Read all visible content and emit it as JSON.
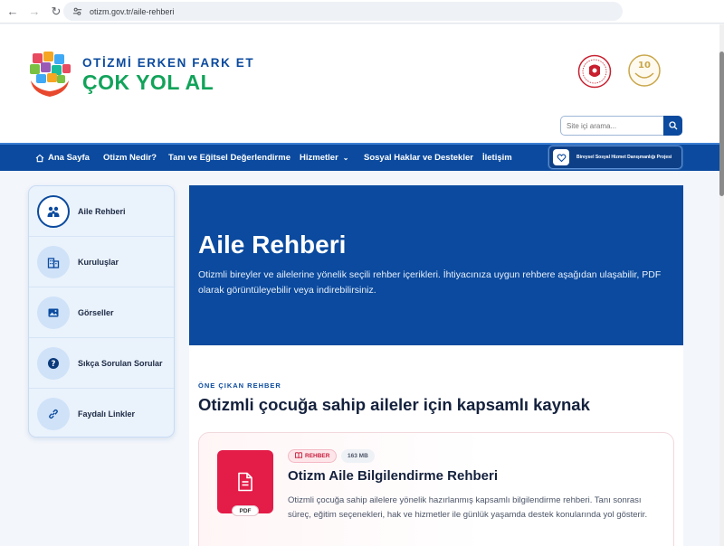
{
  "browser": {
    "url": "otizm.gov.tr/aile-rehberi"
  },
  "header": {
    "logo_line1": "OTİZMİ ERKEN FARK ET",
    "logo_line2": "ÇOK YOL AL",
    "search_placeholder": "Site içi arama..."
  },
  "nav": {
    "items": [
      {
        "label": "Ana Sayfa"
      },
      {
        "label": "Otizm Nedir?"
      },
      {
        "label": "Tanı ve Eğitsel Değerlendirme"
      },
      {
        "label": "Hizmetler"
      },
      {
        "label": "Sosyal Haklar ve Destekler"
      },
      {
        "label": "İletişim"
      }
    ],
    "project_label": "Bireysel Sosyal Hizmet Danışmanlığı Projesi"
  },
  "sidebar": {
    "items": [
      {
        "label": "Aile Rehberi",
        "icon": "family-icon",
        "active": true
      },
      {
        "label": "Kuruluşlar",
        "icon": "building-icon",
        "active": false
      },
      {
        "label": "Görseller",
        "icon": "image-icon",
        "active": false
      },
      {
        "label": "Sıkça Sorulan Sorular",
        "icon": "question-icon",
        "active": false
      },
      {
        "label": "Faydalı Linkler",
        "icon": "link-icon",
        "active": false
      }
    ]
  },
  "hero": {
    "title": "Aile Rehberi",
    "description": "Otizmli bireyler ve ailelerine yönelik seçili rehber içerikleri. İhtiyacınıza uygun rehbere aşağıdan ulaşabilir, PDF olarak görüntüleyebilir veya indirebilirsiniz."
  },
  "featured": {
    "eyebrow": "ÖNE ÇIKAN REHBER",
    "title": "Otizmli çocuğa sahip aileler için kapsamlı kaynak",
    "card": {
      "badge": "REHBER",
      "size": "163 MB",
      "file_type": "PDF",
      "title": "Otizm Aile Bilgilendirme Rehberi",
      "description": "Otizmli çocuğa sahip ailelere yönelik hazırlanmış kapsamlı bilgilendirme rehberi. Tanı sonrası süreç, eğitim seçenekleri, hak ve hizmetler ile günlük yaşamda destek konularında yol gösterir."
    }
  },
  "colors": {
    "primary_blue": "#0b4a9e",
    "brand_green": "#12a35a",
    "pdf_red": "#e31c48"
  }
}
